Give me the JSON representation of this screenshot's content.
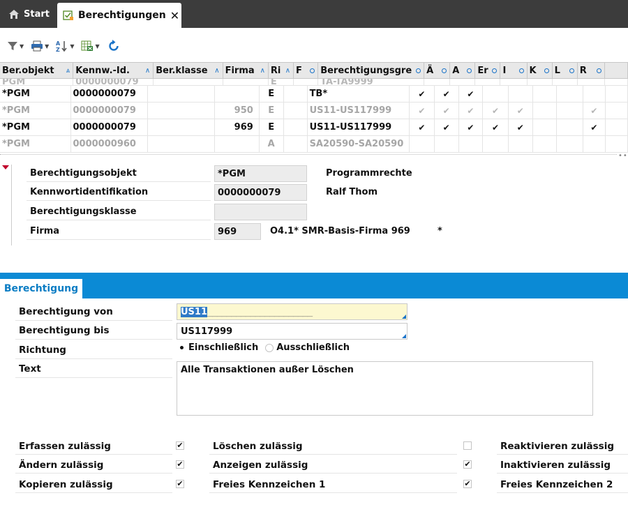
{
  "tabs": {
    "start_label": "Start",
    "active_label": "Berechtigungen",
    "close_glyph": "✕"
  },
  "toolbar": {
    "buttons": [
      "filter-icon",
      "print-icon",
      "sort-az-icon",
      "excel-export-icon",
      "refresh-icon"
    ]
  },
  "grid": {
    "columns": [
      "Ber.objekt",
      "Kennw.-Id.",
      "Ber.klasse",
      "Firma",
      "Ri",
      "F",
      "Berechtigungsgre",
      "Ä",
      "A",
      "Er",
      "I",
      "K",
      "L",
      "R",
      ""
    ],
    "partial_row": [
      "PGM",
      "0000000079",
      "",
      "",
      "E",
      "",
      "TA-TA9999"
    ],
    "rows": [
      {
        "state": "active",
        "cells": [
          "*PGM",
          "0000000079",
          "",
          "",
          "E",
          "",
          "TB*"
        ],
        "checks": [
          true,
          true,
          true,
          false,
          false,
          false,
          false,
          false
        ]
      },
      {
        "state": "dim",
        "cells": [
          "*PGM",
          "0000000079",
          "",
          "950",
          "E",
          "",
          "US11-US117999"
        ],
        "checks": [
          true,
          true,
          true,
          true,
          true,
          false,
          false,
          true
        ]
      },
      {
        "state": "active",
        "cells": [
          "*PGM",
          "0000000079",
          "",
          "969",
          "E",
          "",
          "US11-US117999"
        ],
        "checks": [
          true,
          true,
          true,
          true,
          true,
          false,
          false,
          true
        ]
      },
      {
        "state": "dim",
        "cells": [
          "*PGM",
          "0000000960",
          "",
          "",
          "A",
          "",
          "SA20590-SA20590"
        ],
        "checks": [
          false,
          false,
          false,
          false,
          false,
          false,
          false,
          false
        ]
      }
    ],
    "check_glyph": "✔"
  },
  "detail": {
    "objekt_label": "Berechtigungsobjekt",
    "objekt_value": "*PGM",
    "objekt_desc": "Programmrechte",
    "kennwort_label": "Kennwortidentifikation",
    "kennwort_value": "0000000079",
    "kennwort_desc": "Ralf Thom",
    "klasse_label": "Berechtigungsklasse",
    "klasse_value": "",
    "firma_label": "Firma",
    "firma_value": "969",
    "firma_desc": "O4.1* SMR-Basis-Firma 969",
    "firma_star": "*"
  },
  "section": {
    "tab_label": "Berechtigung",
    "von_label": "Berechtigung von",
    "von_value": "US11",
    "von_fill": "______________________",
    "bis_label": "Berechtigung bis",
    "bis_value": "US117999",
    "richtung_label": "Richtung",
    "radio_incl": "Einschließlich",
    "radio_excl": "Ausschließlich",
    "text_label": "Text",
    "text_value": "Alle Transaktionen außer Löschen"
  },
  "permissions": {
    "erfassen": "Erfassen zulässig",
    "aendern": "Ändern zulässig",
    "kopieren": "Kopieren zulässig",
    "loeschen": "Löschen zulässig",
    "anzeigen": "Anzeigen zulässig",
    "freies1": "Freies Kennzeichen 1",
    "reaktivieren": "Reaktivieren zulässig",
    "inaktivieren": "Inaktivieren zulässig",
    "freies2": "Freies Kennzeichen 2",
    "check_glyph": "✔"
  },
  "colors": {
    "accent": "#0b8ad5",
    "tabbar": "#3c3c3c",
    "marker": "#c0002b"
  }
}
